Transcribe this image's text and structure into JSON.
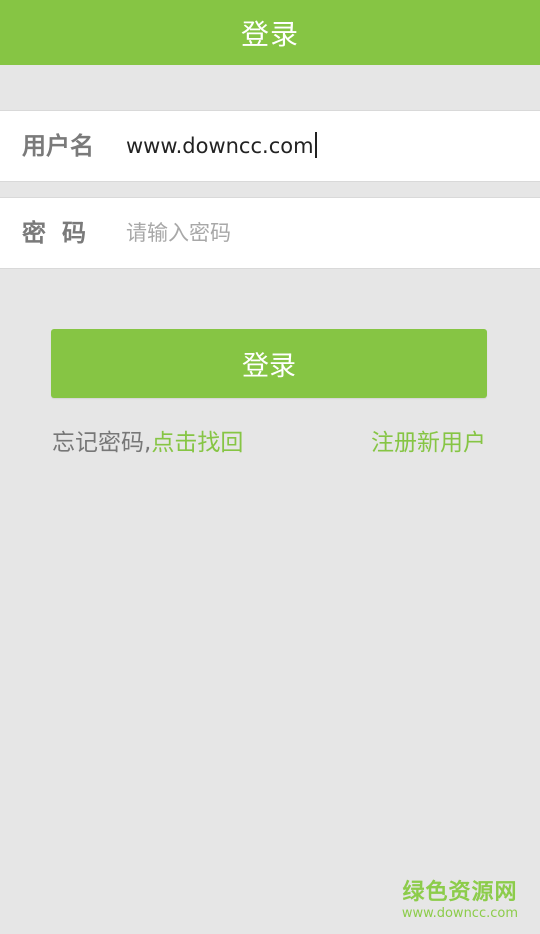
{
  "header": {
    "title": "登录"
  },
  "form": {
    "username_label": "用户名",
    "username_value": "www.downcc.com",
    "password_label": "密码",
    "password_placeholder": "请输入密码"
  },
  "actions": {
    "login_label": "登录",
    "forgot_prefix": "忘记密码,",
    "forgot_link": "点击找回",
    "register_link": "注册新用户"
  },
  "watermark": {
    "name": "绿色资源网",
    "url": "www.downcc.com"
  },
  "colors": {
    "accent": "#86c544",
    "background": "#e6e6e6",
    "field_background": "#ffffff"
  }
}
